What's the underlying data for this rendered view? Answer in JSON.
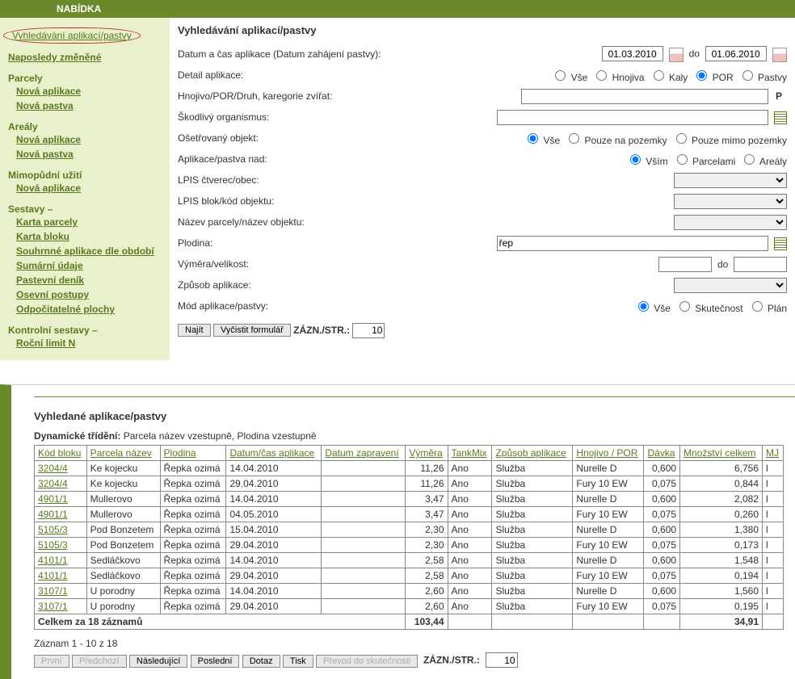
{
  "menu_title": "NABÍDKA",
  "sidebar": {
    "top": "Vyhledávání aplikací/pastvy",
    "recent": "Naposledy změněné",
    "parcely": "Parcely",
    "parcely_new_app": "Nová aplikace",
    "parcely_new_past": "Nová pastva",
    "arealy": "Areály",
    "arealy_new_app": "Nová aplikace",
    "arealy_new_past": "Nová pastva",
    "mimo": "Mimopůdní užití",
    "mimo_new_app": "Nová aplikace",
    "sestavy": "Sestavy –",
    "sestavy_items": [
      "Karta parcely",
      "Karta bloku",
      "Souhrnné aplikace dle období",
      "Sumární údaje",
      "Pastevní deník",
      "Osevní postupy",
      "Odpočitatelné plochy"
    ],
    "kontrol": "Kontrolní sestavy –",
    "kontrol_items": [
      "Roční limit N"
    ]
  },
  "form": {
    "heading": "Vyhledávání aplikací/pastvy",
    "labels": {
      "date": "Datum a čas aplikace (Datum zahájení pastvy):",
      "to": "do",
      "detail": "Detail aplikace:",
      "hnoj": "Hnojivo/POR/Druh, karegorie zvířat:",
      "skod": "Škodlivý organismus:",
      "oset": "Ošetřovaný objekt:",
      "nad": "Aplikace/pastva nad:",
      "lpis_ct": "LPIS čtverec/obec:",
      "lpis_bl": "LPIS blok/kód objektu:",
      "nazev": "Název parcely/název objektu:",
      "plodina": "Plodina:",
      "vymera": "Výměra/velikost:",
      "zpusob": "Způsob aplikace:",
      "mod": "Mód aplikace/pastvy:"
    },
    "vals": {
      "date_from": "01.03.2010",
      "date_to": "01.06.2010",
      "hnoj": "",
      "skod": "",
      "lpis_ct": "",
      "lpis_bl": "",
      "nazev": "",
      "plodina": "řep",
      "vymera_from": "",
      "vymera_to": "",
      "zpusob": ""
    },
    "radios": {
      "detail": [
        "Vše",
        "Hnojiva",
        "Kaly",
        "POR",
        "Pastvy"
      ],
      "oset": [
        "Vše",
        "Pouze na pozemky",
        "Pouze mimo pozemky"
      ],
      "nad": [
        "Vším",
        "Parcelami",
        "Areály"
      ],
      "mod": [
        "Vše",
        "Skutečnost",
        "Plán"
      ]
    },
    "buttons": {
      "find": "Najít",
      "clear": "Vyčistit formulář",
      "records": "ZÁZN./STR.:",
      "records_val": "10"
    },
    "p_suffix": "P"
  },
  "results": {
    "heading": "Vyhledané aplikace/pastvy",
    "sort_label": "Dynamické třídění:",
    "sort_text": "Parcela název vzestupně, Plodina vzestupně",
    "cols": [
      "Kód bloku",
      "Parcela název",
      "Plodina",
      "Datum/čas aplikace",
      "Datum zapravení",
      "Výměra",
      "TankMix",
      "Způsob aplikace",
      "Hnojivo / POR",
      "Dávka",
      "Množství celkem",
      "MJ"
    ],
    "rows": [
      [
        "3204/4",
        "Ke kojecku",
        "Řepka ozimá",
        "14.04.2010",
        "",
        "11,26",
        "Ano",
        "Služba",
        "Nurelle D",
        "0,600",
        "6,756",
        "l"
      ],
      [
        "3204/4",
        "Ke kojecku",
        "Řepka ozimá",
        "29.04.2010",
        "",
        "11,26",
        "Ano",
        "Služba",
        "Fury 10 EW",
        "0,075",
        "0,844",
        "l"
      ],
      [
        "4901/1",
        "Mullerovo",
        "Řepka ozimá",
        "14.04.2010",
        "",
        "3,47",
        "Ano",
        "Služba",
        "Nurelle D",
        "0,600",
        "2,082",
        "l"
      ],
      [
        "4901/1",
        "Mullerovo",
        "Řepka ozimá",
        "04.05.2010",
        "",
        "3,47",
        "Ano",
        "Služba",
        "Fury 10 EW",
        "0,075",
        "0,260",
        "l"
      ],
      [
        "5105/3",
        "Pod Bonzetem",
        "Řepka ozimá",
        "15.04.2010",
        "",
        "2,30",
        "Ano",
        "Služba",
        "Nurelle D",
        "0,600",
        "1,380",
        "l"
      ],
      [
        "5105/3",
        "Pod Bonzetem",
        "Řepka ozimá",
        "29.04.2010",
        "",
        "2,30",
        "Ano",
        "Služba",
        "Fury 10 EW",
        "0,075",
        "0,173",
        "l"
      ],
      [
        "4101/1",
        "Sedláčkovo",
        "Řepka ozimá",
        "14.04.2010",
        "",
        "2,58",
        "Ano",
        "Služba",
        "Nurelle D",
        "0,600",
        "1,548",
        "l"
      ],
      [
        "4101/1",
        "Sedláčkovo",
        "Řepka ozimá",
        "29.04.2010",
        "",
        "2,58",
        "Ano",
        "Služba",
        "Fury 10 EW",
        "0,075",
        "0,194",
        "l"
      ],
      [
        "3107/1",
        "U porodny",
        "Řepka ozimá",
        "14.04.2010",
        "",
        "2,60",
        "Ano",
        "Služba",
        "Nurelle D",
        "0,600",
        "1,560",
        "l"
      ],
      [
        "3107/1",
        "U porodny",
        "Řepka ozimá",
        "29.04.2010",
        "",
        "2,60",
        "Ano",
        "Služba",
        "Fury 10 EW",
        "0,075",
        "0,195",
        "l"
      ]
    ],
    "totals": {
      "label": "Celkem za 18 záznamů",
      "vymera": "103,44",
      "mnoz": "34,91"
    },
    "pager": {
      "info": "Záznam 1 - 10 z 18",
      "first": "První",
      "prev": "Předchozí",
      "next": "Následující",
      "last": "Poslední",
      "query": "Dotaz",
      "print": "Tisk",
      "convert": "Převod do skutečnosti",
      "records": "ZÁZN./STR.:",
      "records_val": "10"
    }
  }
}
